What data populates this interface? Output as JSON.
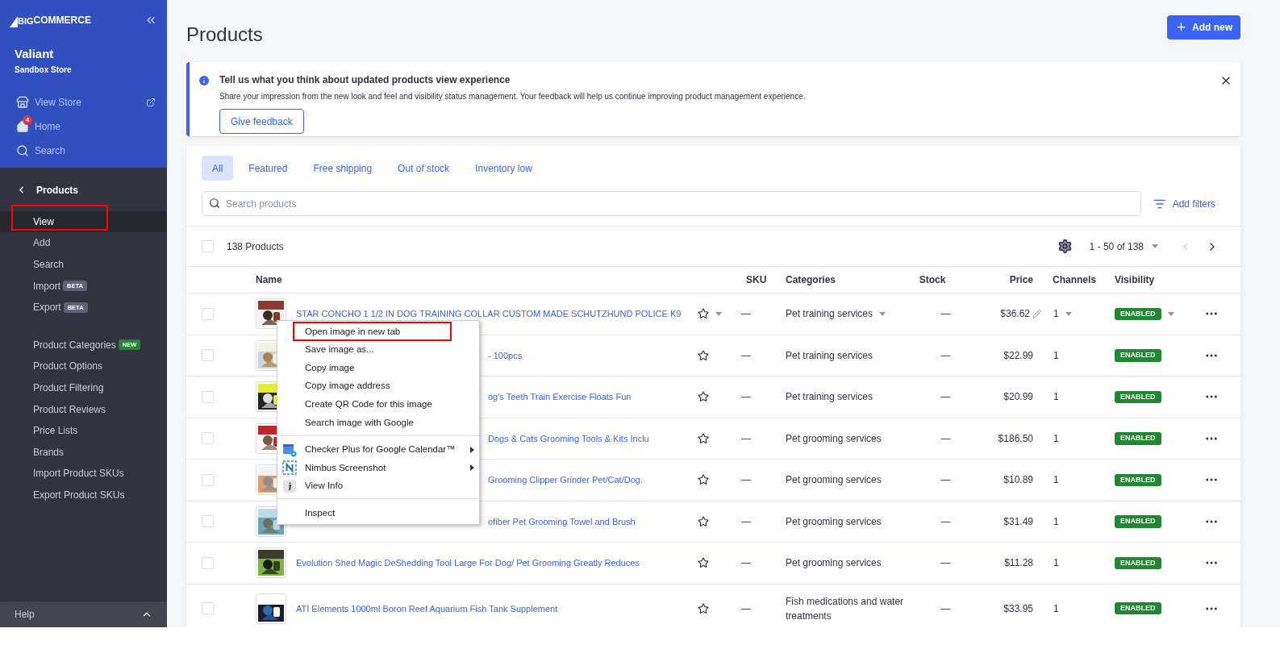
{
  "sidebar": {
    "logo": {
      "mark": "BIG",
      "text": "COMMERCE"
    },
    "store_name": "Valiant",
    "store_type": "Sandbox Store",
    "top_links": [
      {
        "kind": "store",
        "label": "View Store"
      },
      {
        "kind": "home",
        "label": "Home",
        "badge": "4"
      },
      {
        "kind": "search",
        "label": "Search"
      }
    ],
    "section": "Products",
    "items": [
      {
        "label": "View",
        "selected": true,
        "highlighted": true
      },
      {
        "label": "Add",
        "selected": false,
        "highlighted": false
      },
      {
        "label": "Search",
        "selected": false,
        "highlighted": false
      },
      {
        "label": "Import",
        "badge": "BETA",
        "color": "#5e637a",
        "selected": false,
        "highlighted": false
      },
      {
        "label": "Export",
        "badge": "BETA",
        "color": "#5e637a",
        "selected": false,
        "highlighted": false,
        "gap_after": true
      },
      {
        "label": "Product Categories",
        "badge": "NEW",
        "color": "#208831",
        "selected": false,
        "highlighted": false
      },
      {
        "label": "Product Options",
        "selected": false,
        "highlighted": false
      },
      {
        "label": "Product Filtering",
        "selected": false,
        "highlighted": false
      },
      {
        "label": "Product Reviews",
        "selected": false,
        "highlighted": false
      },
      {
        "label": "Price Lists",
        "selected": false,
        "highlighted": false
      },
      {
        "label": "Brands",
        "selected": false,
        "highlighted": false
      },
      {
        "label": "Import Product SKUs",
        "selected": false,
        "highlighted": false
      },
      {
        "label": "Export Product SKUs",
        "selected": false,
        "highlighted": false
      }
    ],
    "help": "Help"
  },
  "page_title": "Products",
  "add_button": "Add new",
  "banner": {
    "title": "Tell us what you think about updated products view experience",
    "text": "Share your impression from the new look and feel and visibility status management. Your feedback will help us continue improving product management experience.",
    "button": "Give feedback"
  },
  "tabs": [
    {
      "label": "All",
      "selected": true
    },
    {
      "label": "Featured",
      "selected": false
    },
    {
      "label": "Free shipping",
      "selected": false
    },
    {
      "label": "Out of stock",
      "selected": false
    },
    {
      "label": "Inventory low",
      "selected": false
    }
  ],
  "search": {
    "placeholder": "Search products"
  },
  "add_filters": "Add filters",
  "summary": {
    "checked": false,
    "count": "138 Products",
    "pagination": "1 - 50 of 138"
  },
  "table": {
    "columns": [
      "Name",
      "SKU",
      "Categories",
      "Stock",
      "Price",
      "Channels",
      "Visibility"
    ],
    "rows": [
      {
        "checked": false,
        "hovered": true,
        "covered": false,
        "name": "STAR CONCHO 1 1/2 IN DOG TRAINING COLLAR CUSTOM MADE SCHUTZHUND POLICE K9",
        "sku": "—",
        "category": "Pet training services",
        "stock": "—",
        "price": "$36.62",
        "channels": "1",
        "visibility": "ENABLED"
      },
      {
        "checked": false,
        "hovered": false,
        "covered": true,
        "name": "- 100pcs",
        "sku": "—",
        "category": "Pet training services",
        "stock": "—",
        "price": "$22.99",
        "channels": "1",
        "visibility": "ENABLED"
      },
      {
        "checked": false,
        "hovered": false,
        "covered": true,
        "name": "og's Teeth Train Exercise Floats Fun",
        "sku": "—",
        "category": "Pet training services",
        "stock": "—",
        "price": "$20.99",
        "channels": "1",
        "visibility": "ENABLED"
      },
      {
        "checked": false,
        "hovered": false,
        "covered": true,
        "name": "Dogs & Cats Grooming Tools & Kits Inclu",
        "sku": "—",
        "category": "Pet grooming services",
        "stock": "—",
        "price": "$186.50",
        "channels": "1",
        "visibility": "ENABLED"
      },
      {
        "checked": false,
        "hovered": false,
        "covered": true,
        "name": "Grooming Clipper Grinder Pet/Cat/Dog.",
        "sku": "—",
        "category": "Pet grooming services",
        "stock": "—",
        "price": "$10.89",
        "channels": "1",
        "visibility": "ENABLED"
      },
      {
        "checked": false,
        "hovered": false,
        "covered": true,
        "name": "ofiber Pet Grooming Towel and Brush",
        "sku": "—",
        "category": "Pet grooming services",
        "stock": "—",
        "price": "$31.49",
        "channels": "1",
        "visibility": "ENABLED"
      },
      {
        "checked": false,
        "hovered": false,
        "covered": false,
        "name": "Evolution Shed Magic DeShedding Tool Large For Dog/ Pet Grooming Greatly Reduces",
        "sku": "—",
        "category": "Pet grooming services",
        "stock": "—",
        "price": "$11.28",
        "channels": "1",
        "visibility": "ENABLED"
      },
      {
        "checked": false,
        "hovered": false,
        "covered": false,
        "name": "ATI Elements 1000ml Boron Reef Aquarium Fish Tank Supplement",
        "sku": "—",
        "category": "Fish medications and water treatments",
        "stock": "—",
        "price": "$33.95",
        "channels": "1",
        "visibility": "ENABLED"
      }
    ]
  },
  "context_menu": {
    "groups": [
      [
        {
          "label": "Open image in new tab",
          "highlighted": true
        },
        {
          "label": "Save image as...",
          "highlighted": false
        },
        {
          "label": "Copy image",
          "highlighted": false
        },
        {
          "label": "Copy image address",
          "highlighted": false
        },
        {
          "label": "Create QR Code for this image",
          "highlighted": false
        },
        {
          "label": "Search image with Google",
          "highlighted": false
        }
      ],
      [
        {
          "label": "Checker Plus for Google Calendar™",
          "kind": "calendar",
          "submenu": true,
          "highlighted": false
        },
        {
          "label": "Nimbus Screenshot",
          "kind": "nimbus",
          "submenu": true,
          "highlighted": false
        },
        {
          "label": "View Info",
          "kind": "info",
          "submenu": false,
          "highlighted": false
        }
      ],
      [
        {
          "label": "Inspect",
          "highlighted": false
        }
      ]
    ]
  }
}
